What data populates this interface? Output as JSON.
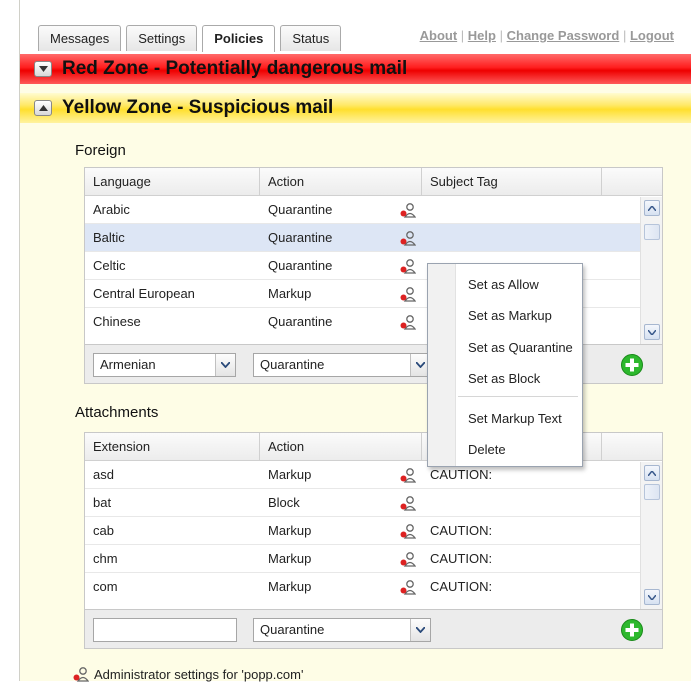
{
  "tabs": [
    {
      "label": "Messages",
      "active": false
    },
    {
      "label": "Settings",
      "active": false
    },
    {
      "label": "Policies",
      "active": true
    },
    {
      "label": "Status",
      "active": false
    }
  ],
  "top_links": {
    "about": "About",
    "help": "Help",
    "change_password": "Change Password",
    "logout": "Logout",
    "separator": "|"
  },
  "zones": {
    "red": {
      "title": "Red Zone - Potentially dangerous mail",
      "color": "#ff2020",
      "state": "collapsed"
    },
    "yellow": {
      "title": "Yellow Zone - Suspicious mail",
      "color": "#ffe033",
      "state": "expanded"
    }
  },
  "foreign": {
    "title": "Foreign",
    "columns": [
      "Language",
      "Action",
      "Subject Tag"
    ],
    "rows": [
      {
        "language": "Arabic",
        "action": "Quarantine",
        "tag": "",
        "icon": "admin-icon"
      },
      {
        "language": "Baltic",
        "action": "Quarantine",
        "tag": "",
        "icon": "admin-icon",
        "selected": true
      },
      {
        "language": "Celtic",
        "action": "Quarantine",
        "tag": "",
        "icon": "admin-icon"
      },
      {
        "language": "Central European",
        "action": "Markup",
        "tag": "",
        "icon": "admin-icon"
      },
      {
        "language": "Chinese",
        "action": "Quarantine",
        "tag": "",
        "icon": "admin-icon"
      }
    ],
    "add_bar": {
      "language_value": "Armenian",
      "action_value": "Quarantine"
    }
  },
  "attachments": {
    "title": "Attachments",
    "columns": [
      "Extension",
      "Action",
      ""
    ],
    "rows": [
      {
        "ext": "asd",
        "action": "Markup",
        "tag": "CAUTION:"
      },
      {
        "ext": "bat",
        "action": "Block",
        "tag": ""
      },
      {
        "ext": "cab",
        "action": "Markup",
        "tag": "CAUTION:"
      },
      {
        "ext": "chm",
        "action": "Markup",
        "tag": "CAUTION:"
      },
      {
        "ext": "com",
        "action": "Markup",
        "tag": "CAUTION:"
      }
    ],
    "add_bar": {
      "extension_value": "",
      "action_value": "Quarantine"
    }
  },
  "context_menu": {
    "items": [
      "Set as Allow",
      "Set as Markup",
      "Set as Quarantine",
      "Set as Block",
      "Set Markup Text",
      "Delete"
    ]
  },
  "footer": {
    "text": "Administrator settings for 'popp.com'"
  },
  "colors": {
    "add_button": "#2db82d",
    "selected_row": "#dde6f5",
    "page_bg": "#fefde6"
  }
}
